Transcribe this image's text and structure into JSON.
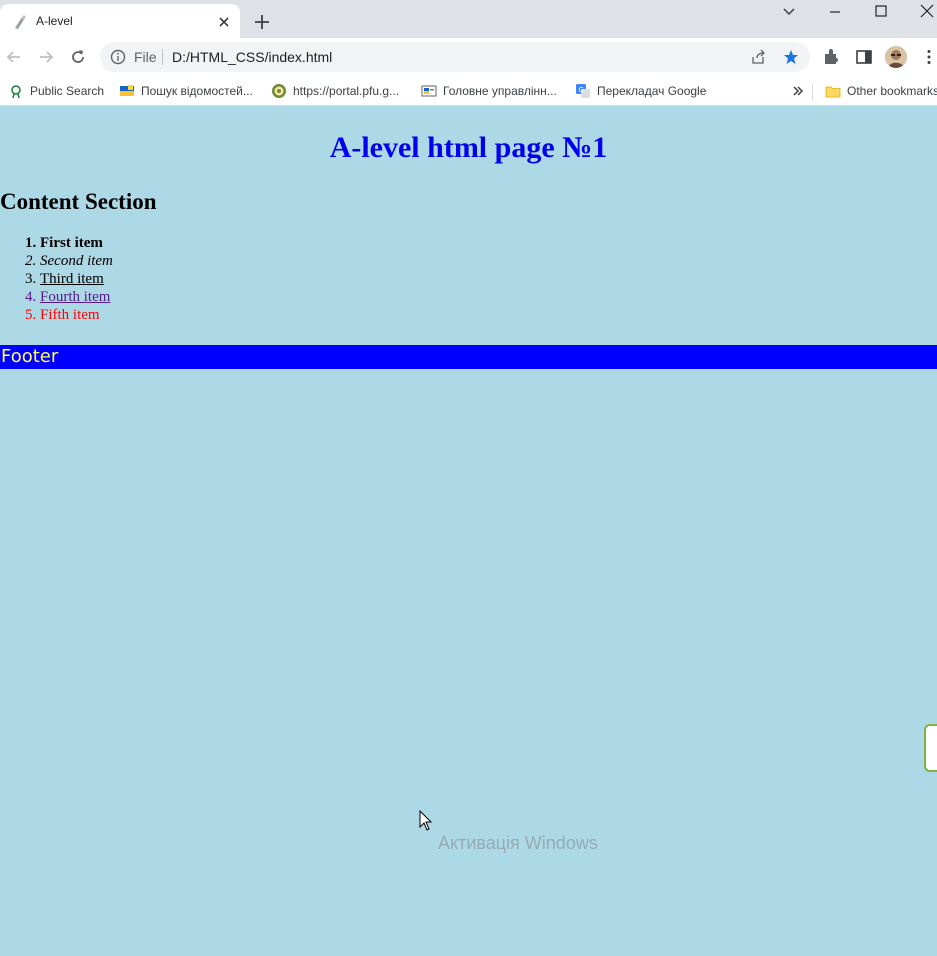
{
  "tab": {
    "title": "A-level"
  },
  "omnibox": {
    "scheme": "File",
    "url": "D:/HTML_CSS/index.html"
  },
  "bookmarks": [
    {
      "label": "Public Search",
      "icon": "search-fox-icon"
    },
    {
      "label": "Пошук відомостей...",
      "icon": "ukraine-flag-icon"
    },
    {
      "label": "https://portal.pfu.g...",
      "icon": "emblem-icon"
    },
    {
      "label": "Головне управлінн...",
      "icon": "flag-icon"
    },
    {
      "label": "Перекладач Google",
      "icon": "google-translate-icon"
    }
  ],
  "bookmarks_other": "Other bookmarks",
  "page": {
    "title": "A-level html page №1",
    "section_title": "Content Section",
    "items": [
      "First item",
      "Second item",
      "Third item",
      "Fourth item",
      "Fifth item"
    ],
    "footer": "Footer"
  },
  "watermark": "Активація Windows",
  "colors": {
    "page_bg": "#add8e6",
    "title": "#0000ee",
    "footer_bg": "#0000ff",
    "footer_text": "#ffff66",
    "fifth_item": "#ff0000"
  }
}
